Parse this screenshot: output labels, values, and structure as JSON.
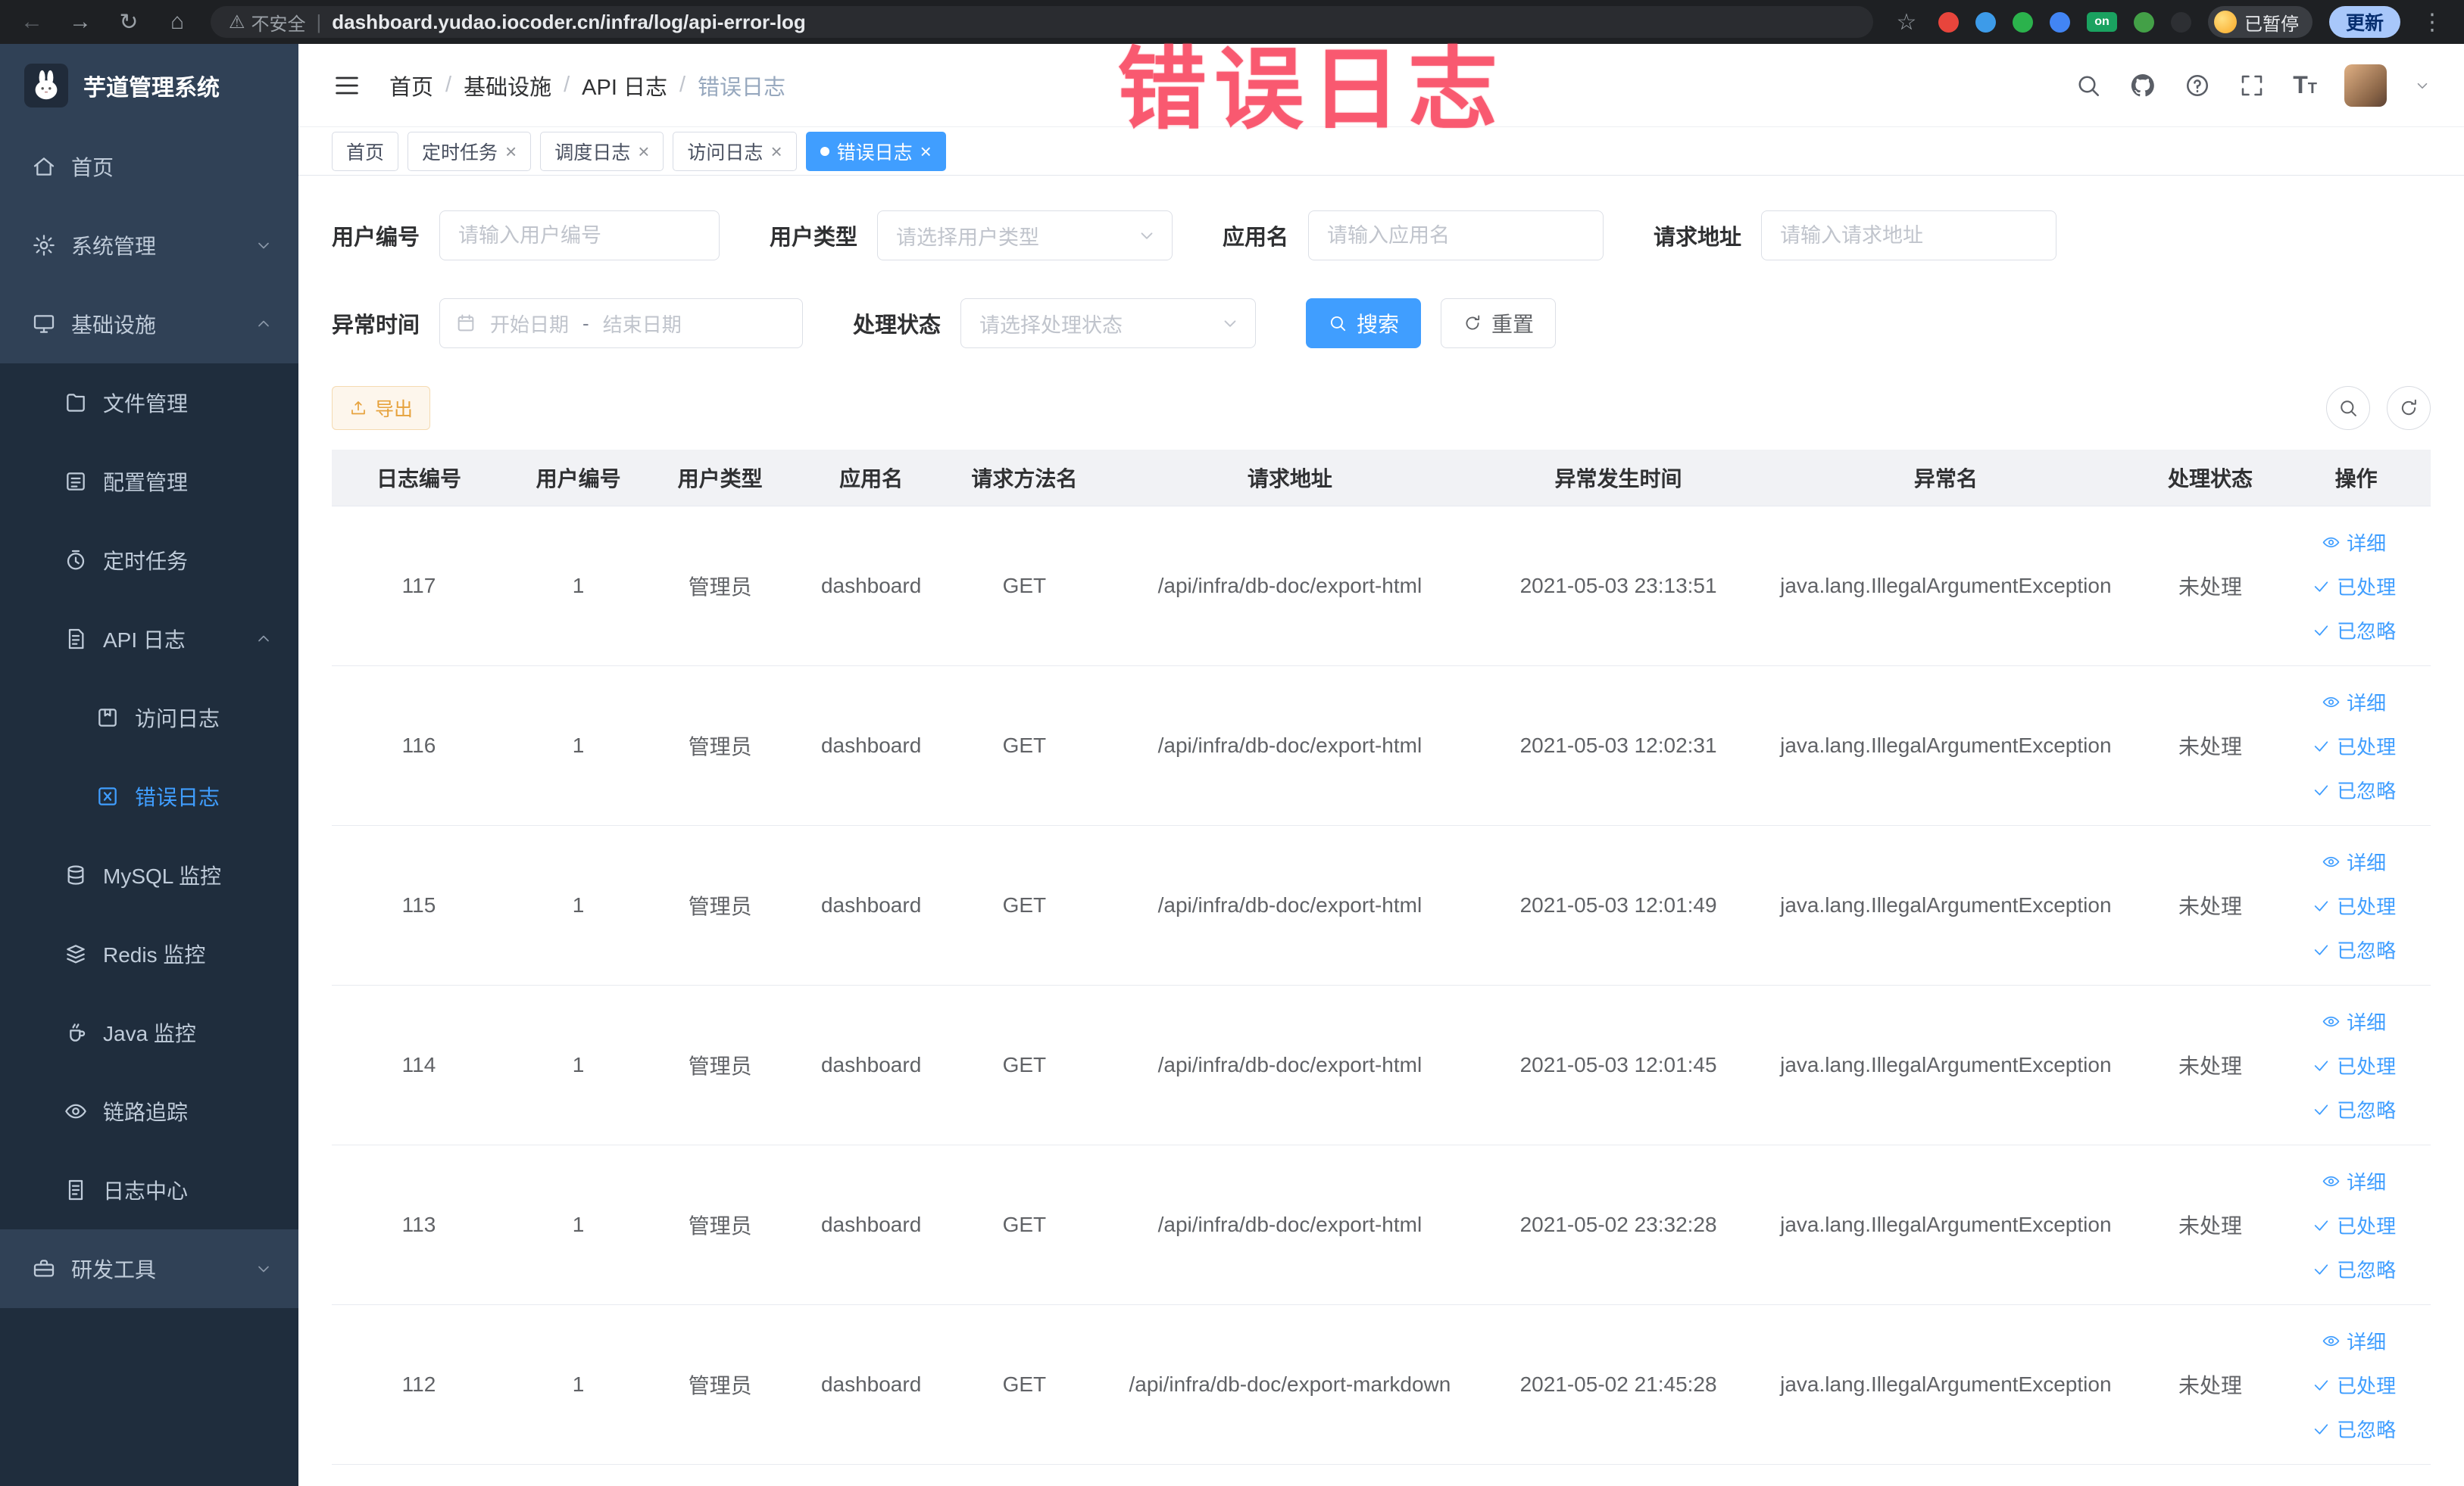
{
  "browser": {
    "security": "不安全",
    "url": "dashboard.yudao.iocoder.cn/infra/log/api-error-log",
    "paused": "已暂停",
    "update": "更新",
    "extensions": [
      {
        "name": "ext-red-circle",
        "color": "#e8453c",
        "label": ""
      },
      {
        "name": "ext-blue-drop",
        "color": "#3d9be9",
        "label": ""
      },
      {
        "name": "ext-green-circle",
        "color": "#2bb24c",
        "label": ""
      },
      {
        "name": "ext-blue-grid",
        "color": "#4285f4",
        "label": ""
      },
      {
        "name": "ext-on-badge",
        "color": "#1aa260",
        "label": "on"
      },
      {
        "name": "ext-green-leaf",
        "color": "#43a047",
        "label": ""
      },
      {
        "name": "ext-dark-paw",
        "color": "#2d2f33",
        "label": ""
      }
    ]
  },
  "icons": {
    "back": "←",
    "forward": "→",
    "reload": "↻",
    "home": "⌂",
    "star": "☆",
    "kebab": "⋮",
    "warning": "⚠",
    "close": "×",
    "fontsize_big": "T",
    "fontsize_small": "T"
  },
  "watermark": "错误日志",
  "sidebar": {
    "title": "芋道管理系统",
    "items": [
      {
        "label": "首页",
        "icon": "home-icon",
        "level": 1,
        "zone": "base",
        "arrow": null,
        "active": false
      },
      {
        "label": "系统管理",
        "icon": "gear-icon",
        "level": 1,
        "zone": "base",
        "arrow": "down",
        "active": false
      },
      {
        "label": "基础设施",
        "icon": "infrastructure-icon",
        "level": 1,
        "zone": "base",
        "arrow": "up",
        "active": false
      },
      {
        "label": "文件管理",
        "icon": "file-icon",
        "level": 2,
        "zone": "sub",
        "arrow": null,
        "active": false
      },
      {
        "label": "配置管理",
        "icon": "config-icon",
        "level": 2,
        "zone": "sub",
        "arrow": null,
        "active": false
      },
      {
        "label": "定时任务",
        "icon": "timer-icon",
        "level": 2,
        "zone": "sub",
        "arrow": null,
        "active": false
      },
      {
        "label": "API 日志",
        "icon": "api-log-icon",
        "level": 2,
        "zone": "sub",
        "arrow": "up",
        "active": false
      },
      {
        "label": "访问日志",
        "icon": "access-log-icon",
        "level": 3,
        "zone": "sub",
        "arrow": null,
        "active": false
      },
      {
        "label": "错误日志",
        "icon": "error-log-icon",
        "level": 3,
        "zone": "sub",
        "arrow": null,
        "active": true
      },
      {
        "label": "MySQL 监控",
        "icon": "mysql-icon",
        "level": 2,
        "zone": "sub",
        "arrow": null,
        "active": false
      },
      {
        "label": "Redis 监控",
        "icon": "redis-icon",
        "level": 2,
        "zone": "sub",
        "arrow": null,
        "active": false
      },
      {
        "label": "Java 监控",
        "icon": "java-icon",
        "level": 2,
        "zone": "sub",
        "arrow": null,
        "active": false
      },
      {
        "label": "链路追踪",
        "icon": "trace-icon",
        "level": 2,
        "zone": "sub",
        "arrow": null,
        "active": false
      },
      {
        "label": "日志中心",
        "icon": "log-center-icon",
        "level": 2,
        "zone": "sub",
        "arrow": null,
        "active": false
      },
      {
        "label": "研发工具",
        "icon": "tools-icon",
        "level": 1,
        "zone": "base",
        "arrow": "down",
        "active": false
      }
    ]
  },
  "header": {
    "breadcrumb": [
      "首页",
      "基础设施",
      "API 日志",
      "错误日志"
    ],
    "breadcrumb_separator": "/"
  },
  "tabs": [
    {
      "label": "首页",
      "closable": false,
      "active": false
    },
    {
      "label": "定时任务",
      "closable": true,
      "active": false
    },
    {
      "label": "调度日志",
      "closable": true,
      "active": false
    },
    {
      "label": "访问日志",
      "closable": true,
      "active": false
    },
    {
      "label": "错误日志",
      "closable": true,
      "active": true
    }
  ],
  "filters": {
    "user_id": {
      "label": "用户编号",
      "placeholder": "请输入用户编号",
      "value": ""
    },
    "user_type": {
      "label": "用户类型",
      "placeholder": "请选择用户类型"
    },
    "app_name": {
      "label": "应用名",
      "placeholder": "请输入应用名",
      "value": ""
    },
    "request_url": {
      "label": "请求地址",
      "placeholder": "请输入请求地址",
      "value": ""
    },
    "exception_time": {
      "label": "异常时间",
      "start_placeholder": "开始日期",
      "separator": "-",
      "end_placeholder": "结束日期"
    },
    "process_status": {
      "label": "处理状态",
      "placeholder": "请选择处理状态"
    },
    "search": "搜索",
    "reset": "重置"
  },
  "toolbar": {
    "export": "导出"
  },
  "table": {
    "columns": [
      "日志编号",
      "用户编号",
      "用户类型",
      "应用名",
      "请求方法名",
      "请求地址",
      "异常发生时间",
      "异常名",
      "处理状态",
      "操作"
    ],
    "actions": [
      "详细",
      "已处理",
      "已忽略"
    ],
    "rows": [
      {
        "id": "117",
        "user_id": "1",
        "user_type": "管理员",
        "app": "dashboard",
        "method": "GET",
        "url": "/api/infra/db-doc/export-html",
        "time": "2021-05-03 23:13:51",
        "exception": "java.lang.IllegalArgumentException",
        "status": "未处理"
      },
      {
        "id": "116",
        "user_id": "1",
        "user_type": "管理员",
        "app": "dashboard",
        "method": "GET",
        "url": "/api/infra/db-doc/export-html",
        "time": "2021-05-03 12:02:31",
        "exception": "java.lang.IllegalArgumentException",
        "status": "未处理"
      },
      {
        "id": "115",
        "user_id": "1",
        "user_type": "管理员",
        "app": "dashboard",
        "method": "GET",
        "url": "/api/infra/db-doc/export-html",
        "time": "2021-05-03 12:01:49",
        "exception": "java.lang.IllegalArgumentException",
        "status": "未处理"
      },
      {
        "id": "114",
        "user_id": "1",
        "user_type": "管理员",
        "app": "dashboard",
        "method": "GET",
        "url": "/api/infra/db-doc/export-html",
        "time": "2021-05-03 12:01:45",
        "exception": "java.lang.IllegalArgumentException",
        "status": "未处理"
      },
      {
        "id": "113",
        "user_id": "1",
        "user_type": "管理员",
        "app": "dashboard",
        "method": "GET",
        "url": "/api/infra/db-doc/export-html",
        "time": "2021-05-02 23:32:28",
        "exception": "java.lang.IllegalArgumentException",
        "status": "未处理"
      },
      {
        "id": "112",
        "user_id": "1",
        "user_type": "管理员",
        "app": "dashboard",
        "method": "GET",
        "url": "/api/infra/db-doc/export-markdown",
        "time": "2021-05-02 21:45:28",
        "exception": "java.lang.IllegalArgumentException",
        "status": "未处理"
      }
    ]
  },
  "colors": {
    "accent": "#409eff",
    "warning": "#e6a23c",
    "watermark": "#f84962",
    "sidebar": "#304156",
    "sidebar_sub": "#1f2d3d"
  }
}
